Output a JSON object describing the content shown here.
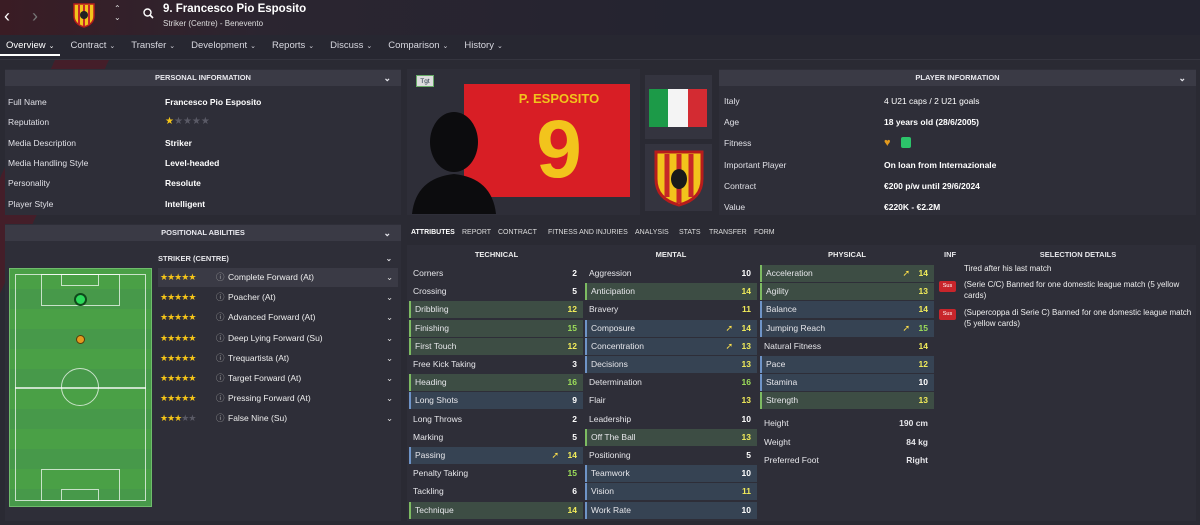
{
  "header": {
    "player_title": "9. Francesco Pio Esposito",
    "player_subtitle": "Striker (Centre) - Benevento"
  },
  "nav": {
    "tabs": [
      {
        "label": "Overview"
      },
      {
        "label": "Contract"
      },
      {
        "label": "Transfer"
      },
      {
        "label": "Development"
      },
      {
        "label": "Reports"
      },
      {
        "label": "Discuss"
      },
      {
        "label": "Comparison"
      },
      {
        "label": "History"
      }
    ]
  },
  "personal": {
    "title": "PERSONAL INFORMATION",
    "rows": [
      {
        "label": "Full Name",
        "value": "Francesco Pio Esposito"
      },
      {
        "label": "Reputation",
        "value": ""
      },
      {
        "label": "Media Description",
        "value": "Striker"
      },
      {
        "label": "Media Handling Style",
        "value": "Level-headed"
      },
      {
        "label": "Personality",
        "value": "Resolute"
      },
      {
        "label": "Player Style",
        "value": "Intelligent"
      }
    ],
    "reputation_stars": 1
  },
  "positional": {
    "title": "POSITIONAL ABILITIES",
    "position_header": "STRIKER (CENTRE)",
    "roles": [
      {
        "name": "Complete Forward (At)",
        "stars": 5
      },
      {
        "name": "Poacher (At)",
        "stars": 5
      },
      {
        "name": "Advanced Forward (At)",
        "stars": 5
      },
      {
        "name": "Deep Lying Forward (Su)",
        "stars": 5
      },
      {
        "name": "Trequartista (At)",
        "stars": 5
      },
      {
        "name": "Target Forward (At)",
        "stars": 5
      },
      {
        "name": "Pressing Forward (At)",
        "stars": 5
      },
      {
        "name": "False Nine (Su)",
        "stars": 3
      }
    ]
  },
  "card": {
    "badge": "Tgt",
    "shirt_name": "P. ESPOSITO",
    "shirt_number": "9"
  },
  "player_info": {
    "title": "PLAYER INFORMATION",
    "rows": [
      {
        "label": "Italy",
        "value": "4 U21 caps / 2 U21 goals"
      },
      {
        "label": "Age",
        "value": "18 years old (28/6/2005)"
      },
      {
        "label": "Fitness",
        "value": ""
      },
      {
        "label": "Important Player",
        "value": "On loan from Internazionale"
      },
      {
        "label": "Contract",
        "value": "€200 p/w until 29/6/2024"
      },
      {
        "label": "Value",
        "value": "€220K - €2.2M"
      }
    ]
  },
  "subtabs": [
    "ATTRIBUTES",
    "REPORT",
    "CONTRACT",
    "FITNESS AND INJURIES",
    "ANALYSIS",
    "STATS",
    "TRANSFER",
    "FORM"
  ],
  "attributes": {
    "technical_title": "TECHNICAL",
    "mental_title": "MENTAL",
    "physical_title": "PHYSICAL",
    "technical": [
      {
        "name": "Corners",
        "value": "2",
        "style": ""
      },
      {
        "name": "Crossing",
        "value": "5",
        "style": ""
      },
      {
        "name": "Dribbling",
        "value": "12",
        "style": "hl"
      },
      {
        "name": "Finishing",
        "value": "15",
        "style": "hl"
      },
      {
        "name": "First Touch",
        "value": "12",
        "style": "hl"
      },
      {
        "name": "Free Kick Taking",
        "value": "3",
        "style": ""
      },
      {
        "name": "Heading",
        "value": "16",
        "style": "hl"
      },
      {
        "name": "Long Shots",
        "value": "9",
        "style": "hb"
      },
      {
        "name": "Long Throws",
        "value": "2",
        "style": ""
      },
      {
        "name": "Marking",
        "value": "5",
        "style": ""
      },
      {
        "name": "Passing",
        "value": "14",
        "style": "hb",
        "arrow": true
      },
      {
        "name": "Penalty Taking",
        "value": "15",
        "style": ""
      },
      {
        "name": "Tackling",
        "value": "6",
        "style": ""
      },
      {
        "name": "Technique",
        "value": "14",
        "style": "hl"
      }
    ],
    "mental": [
      {
        "name": "Aggression",
        "value": "10",
        "style": ""
      },
      {
        "name": "Anticipation",
        "value": "14",
        "style": "hl"
      },
      {
        "name": "Bravery",
        "value": "11",
        "style": ""
      },
      {
        "name": "Composure",
        "value": "14",
        "style": "hb",
        "arrow": true
      },
      {
        "name": "Concentration",
        "value": "13",
        "style": "hb",
        "arrow": true
      },
      {
        "name": "Decisions",
        "value": "13",
        "style": "hb"
      },
      {
        "name": "Determination",
        "value": "16",
        "style": ""
      },
      {
        "name": "Flair",
        "value": "13",
        "style": ""
      },
      {
        "name": "Leadership",
        "value": "10",
        "style": ""
      },
      {
        "name": "Off The Ball",
        "value": "13",
        "style": "hl"
      },
      {
        "name": "Positioning",
        "value": "5",
        "style": ""
      },
      {
        "name": "Teamwork",
        "value": "10",
        "style": "hb"
      },
      {
        "name": "Vision",
        "value": "11",
        "style": "hb"
      },
      {
        "name": "Work Rate",
        "value": "10",
        "style": "hb"
      }
    ],
    "physical": [
      {
        "name": "Acceleration",
        "value": "14",
        "style": "hl",
        "arrow": true
      },
      {
        "name": "Agility",
        "value": "13",
        "style": "hl"
      },
      {
        "name": "Balance",
        "value": "14",
        "style": "hb"
      },
      {
        "name": "Jumping Reach",
        "value": "15",
        "style": "hb",
        "arrow": true
      },
      {
        "name": "Natural Fitness",
        "value": "14",
        "style": ""
      },
      {
        "name": "Pace",
        "value": "12",
        "style": "hb"
      },
      {
        "name": "Stamina",
        "value": "10",
        "style": "hb"
      },
      {
        "name": "Strength",
        "value": "13",
        "style": "hl"
      }
    ],
    "physical_extra": [
      {
        "name": "Height",
        "value": "190 cm"
      },
      {
        "name": "Weight",
        "value": "84 kg"
      },
      {
        "name": "Preferred Foot",
        "value": "Right"
      }
    ]
  },
  "selection": {
    "inf_label": "INF",
    "title": "SELECTION DETAILS",
    "items": [
      {
        "text": "Tired after his last match",
        "badge": ""
      },
      {
        "text": "(Serie C/C) Banned for one domestic league match (5 yellow cards)",
        "badge": "Sus"
      },
      {
        "text": "(Supercoppa di Serie C) Banned for one domestic league match (5 yellow cards)",
        "badge": "Sus"
      }
    ]
  },
  "colors": {
    "accent": "#7dbb62",
    "blue": "#6f94c7",
    "gold": "#f5c518",
    "red": "#c8252b"
  }
}
